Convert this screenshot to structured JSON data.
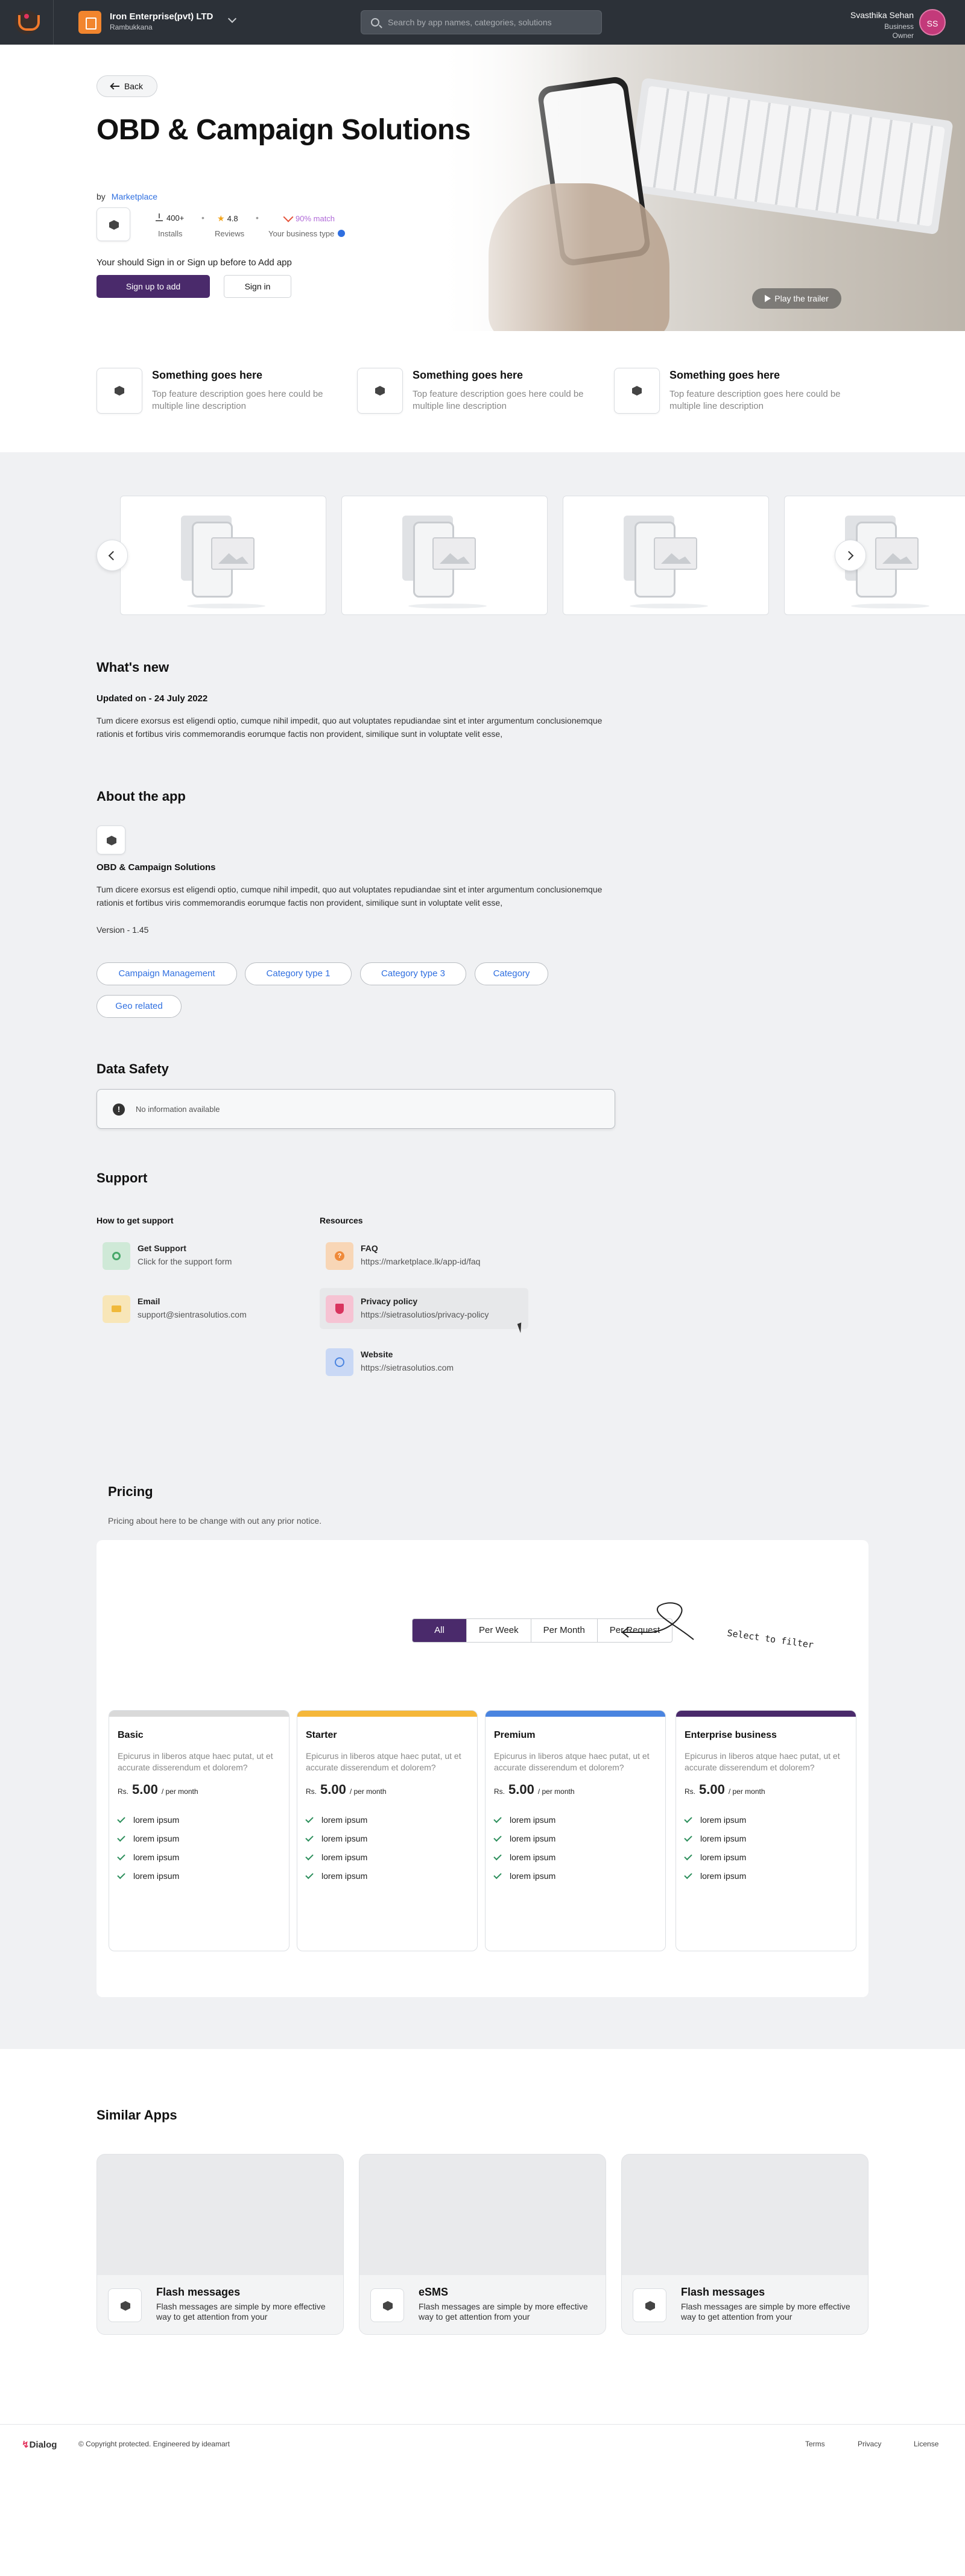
{
  "topbar": {
    "org_name": "Iron Enterprise(pvt) LTD",
    "org_location": "Rambukkana",
    "search_placeholder": "Search by app names, categories, solutions",
    "user_name": "Svasthika Sehan",
    "user_type": "Business",
    "user_role": "Owner",
    "user_initials": "SS"
  },
  "hero": {
    "back_label": "Back",
    "title": "OBD & Campaign Solutions",
    "by_label": "by",
    "publisher": "Marketplace",
    "installs_value": "400+",
    "installs_label": "Installs",
    "rating_value": "4.8",
    "reviews_label": "Reviews",
    "match_value": "90% match",
    "match_label": "Your business type",
    "signin_message": "Your should Sign in or Sign up before to Add app",
    "signup_label": "Sign up to add",
    "signin_label": "Sign in",
    "trailer_label": "Play the trailer"
  },
  "features": [
    {
      "title": "Something goes here",
      "desc": "Top feature description goes here could be multiple line description"
    },
    {
      "title": "Something goes here",
      "desc": "Top feature description goes here could be multiple line description"
    },
    {
      "title": "Something goes here",
      "desc": "Top feature description goes here could be multiple line description"
    }
  ],
  "whats_new": {
    "heading": "What's new",
    "updated": "Updated on - 24 July 2022",
    "body": "Tum dicere exorsus est eligendi optio, cumque nihil impedit, quo aut voluptates repudiandae sint et inter argumentum conclusionemque rationis et fortibus viris commemorandis eorumque factis non provident, similique sunt in voluptate velit esse,"
  },
  "about": {
    "heading": "About the app",
    "app_name": "OBD & Campaign Solutions",
    "body": "Tum dicere exorsus est eligendi optio, cumque nihil impedit, quo aut voluptates repudiandae sint et inter argumentum conclusionemque rationis et fortibus viris commemorandis eorumque factis non provident, similique sunt in voluptate velit esse,",
    "version": "Version - 1.45",
    "tags": [
      "Campaign Management",
      "Category type 1",
      "Category type 3",
      "Category",
      "Geo related"
    ]
  },
  "data_safety": {
    "heading": "Data Safety",
    "message": "No information available"
  },
  "support": {
    "heading": "Support",
    "how_heading": "How to get support",
    "resources_heading": "Resources",
    "how_items": [
      {
        "title": "Get Support",
        "value": "Click for the support form"
      },
      {
        "title": "Email",
        "value": "support@sientrasolutios.com"
      }
    ],
    "resources": [
      {
        "title": "FAQ",
        "value": "https://marketplace.lk/app-id/faq"
      },
      {
        "title": "Privacy policy",
        "value": "https://sietrasolutios/privacy-policy"
      },
      {
        "title": "Website",
        "value": "https://sietrasolutios.com"
      }
    ]
  },
  "pricing": {
    "heading": "Pricing",
    "note": "Pricing about here to be change with out any prior notice.",
    "filters": [
      "All",
      "Per Week",
      "Per Month",
      "Per Request"
    ],
    "filter_hint": "Select to filter",
    "plans": [
      {
        "name": "Basic",
        "color": "#d9d9d9",
        "desc": "Epicurus in liberos atque haec putat, ut et accurate disserendum et dolorem?",
        "currency": "Rs.",
        "price": "5.00",
        "period": "/ per month",
        "features": [
          "lorem ipsum",
          "lorem ipsum",
          "lorem ipsum",
          "lorem ipsum"
        ]
      },
      {
        "name": "Starter",
        "color": "#f5b73a",
        "desc": "Epicurus in liberos atque haec putat, ut et accurate disserendum et dolorem?",
        "currency": "Rs.",
        "price": "5.00",
        "period": "/ per month",
        "features": [
          "lorem ipsum",
          "lorem ipsum",
          "lorem ipsum",
          "lorem ipsum"
        ]
      },
      {
        "name": "Premium",
        "color": "#4a84e0",
        "desc": "Epicurus in liberos atque haec putat, ut et accurate disserendum et dolorem?",
        "currency": "Rs.",
        "price": "5.00",
        "period": "/ per month",
        "features": [
          "lorem ipsum",
          "lorem ipsum",
          "lorem ipsum",
          "lorem ipsum"
        ]
      },
      {
        "name": "Enterprise business",
        "color": "#4a2a6b",
        "desc": "Epicurus in liberos atque haec putat, ut et accurate disserendum et dolorem?",
        "currency": "Rs.",
        "price": "5.00",
        "period": "/ per month",
        "features": [
          "lorem ipsum",
          "lorem ipsum",
          "lorem ipsum",
          "lorem ipsum"
        ]
      }
    ]
  },
  "similar": {
    "heading": "Similar Apps",
    "apps": [
      {
        "title": "Flash messages",
        "desc": "Flash messages are simple by more effective way to get attention from your"
      },
      {
        "title": "eSMS",
        "desc": "Flash messages are simple by more effective way to get attention from your"
      },
      {
        "title": "Flash messages",
        "desc": "Flash messages are simple by more effective way to get attention from your"
      }
    ]
  },
  "footer": {
    "logo": "Dialog",
    "copyright": "© Copyright protected. Engineered by ideamart",
    "links": [
      "Terms",
      "Privacy",
      "License"
    ]
  },
  "colors": {
    "brand_purple": "#4a2a6b",
    "link_blue": "#2f6fe0",
    "topbar": "#2c3138"
  }
}
